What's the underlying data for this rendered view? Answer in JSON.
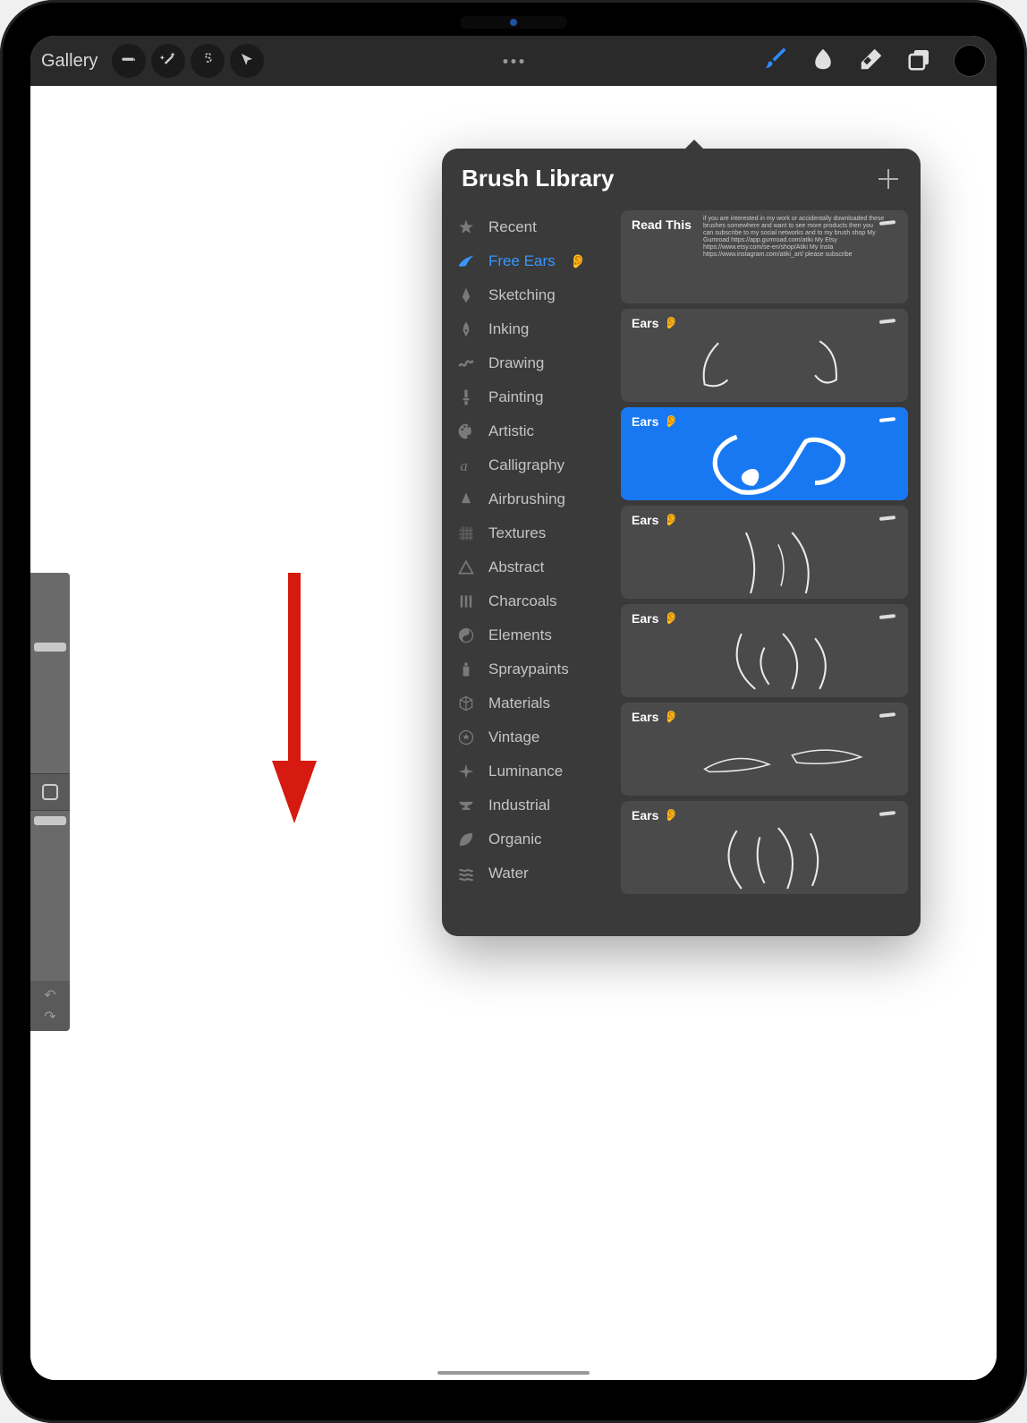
{
  "toolbar": {
    "gallery_label": "Gallery"
  },
  "brush_library": {
    "title": "Brush Library"
  },
  "categories": [
    {
      "label": "Recent",
      "icon": "star"
    },
    {
      "label": "Free Ears",
      "icon": "brushstroke",
      "emoji": "👂",
      "selected": true
    },
    {
      "label": "Sketching",
      "icon": "pencil-tip"
    },
    {
      "label": "Inking",
      "icon": "nib"
    },
    {
      "label": "Drawing",
      "icon": "squiggle"
    },
    {
      "label": "Painting",
      "icon": "paintbrush"
    },
    {
      "label": "Artistic",
      "icon": "palette"
    },
    {
      "label": "Calligraphy",
      "icon": "calligraphy-a"
    },
    {
      "label": "Airbrushing",
      "icon": "spray"
    },
    {
      "label": "Textures",
      "icon": "texture"
    },
    {
      "label": "Abstract",
      "icon": "triangle"
    },
    {
      "label": "Charcoals",
      "icon": "lines"
    },
    {
      "label": "Elements",
      "icon": "yinyang"
    },
    {
      "label": "Spraypaints",
      "icon": "spraycan"
    },
    {
      "label": "Materials",
      "icon": "cube"
    },
    {
      "label": "Vintage",
      "icon": "star-circle"
    },
    {
      "label": "Luminance",
      "icon": "sparkle"
    },
    {
      "label": "Industrial",
      "icon": "anvil"
    },
    {
      "label": "Organic",
      "icon": "leaf"
    },
    {
      "label": "Water",
      "icon": "waves"
    }
  ],
  "brushes": [
    {
      "label": "Read This",
      "kind": "info",
      "selected": false,
      "info_text": "if you are interested in my work or accidentally downloaded these brushes somewhere and want to see more products then you can subscribe to my social networks and to my brush shop My Gumroad https://app.gumroad.com/atiki My Etsy https://www.etsy.com/se-en/shop/Atiki My Insta https://www.instagram.com/atiki_art/ please subscribe"
    },
    {
      "label": "Ears",
      "emoji": "👂",
      "selected": false
    },
    {
      "label": "Ears",
      "emoji": "👂",
      "selected": true
    },
    {
      "label": "Ears",
      "emoji": "👂",
      "selected": false
    },
    {
      "label": "Ears",
      "emoji": "👂",
      "selected": false
    },
    {
      "label": "Ears",
      "emoji": "👂",
      "selected": false
    },
    {
      "label": "Ears",
      "emoji": "👂",
      "selected": false
    }
  ],
  "colors": {
    "accent": "#1878f2",
    "panel": "#3a3a3a",
    "card": "#4a4a4a"
  }
}
